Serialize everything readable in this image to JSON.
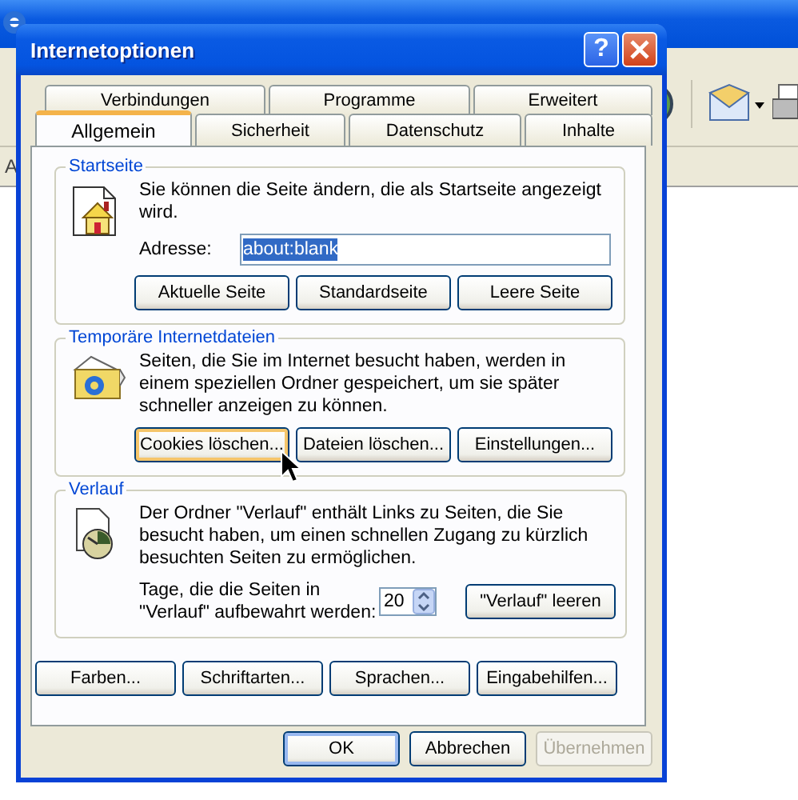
{
  "background_window": {
    "address_label": "A"
  },
  "dialog": {
    "title": "Internetoptionen",
    "help_button": "?"
  },
  "tabs": [
    [
      {
        "label": "Verbindungen",
        "selected": false
      },
      {
        "label": "Programme",
        "selected": false
      },
      {
        "label": "Erweitert",
        "selected": false
      }
    ],
    [
      {
        "label": "Allgemein",
        "selected": true
      },
      {
        "label": "Sicherheit",
        "selected": false
      },
      {
        "label": "Datenschutz",
        "selected": false
      },
      {
        "label": "Inhalte",
        "selected": false
      }
    ]
  ],
  "groups": [
    {
      "kind": "home",
      "title": "Startseite",
      "text": "Sie können die Seite ändern, die als Startseite angezeigt wird.",
      "address_label": "Adresse:",
      "address_value": "about:blank",
      "buttons": [
        {
          "label": "Aktuelle Seite",
          "focused": false
        },
        {
          "label": "Standardseite",
          "focused": false
        },
        {
          "label": "Leere Seite",
          "focused": false
        }
      ]
    },
    {
      "kind": "temp",
      "title": "Temporäre Internetdateien",
      "text": "Seiten, die Sie im Internet besucht haben, werden in einem speziellen Ordner gespeichert, um sie später schneller anzeigen zu können.",
      "buttons": [
        {
          "label": "Cookies löschen...",
          "focused": true
        },
        {
          "label": "Dateien löschen...",
          "focused": false
        },
        {
          "label": "Einstellungen...",
          "focused": false
        }
      ]
    },
    {
      "kind": "history",
      "title": "Verlauf",
      "text": "Der Ordner \"Verlauf\" enthält Links zu Seiten, die Sie besucht haben, um einen schnellen Zugang zu kürzlich besuchten Seiten zu ermöglichen.",
      "days_label": "Tage, die die Seiten in \"Verlauf\" aufbewahrt werden:",
      "days_value": "20",
      "buttons": [
        {
          "label": "\"Verlauf\" leeren",
          "focused": false
        }
      ]
    }
  ],
  "option_buttons": [
    "Farben...",
    "Schriftarten...",
    "Sprachen...",
    "Eingabehilfen..."
  ],
  "dialog_buttons": [
    {
      "label": "OK",
      "disabled": false,
      "default": true
    },
    {
      "label": "Abbrechen",
      "disabled": false,
      "default": false
    },
    {
      "label": "Übernehmen",
      "disabled": true,
      "default": false
    }
  ]
}
